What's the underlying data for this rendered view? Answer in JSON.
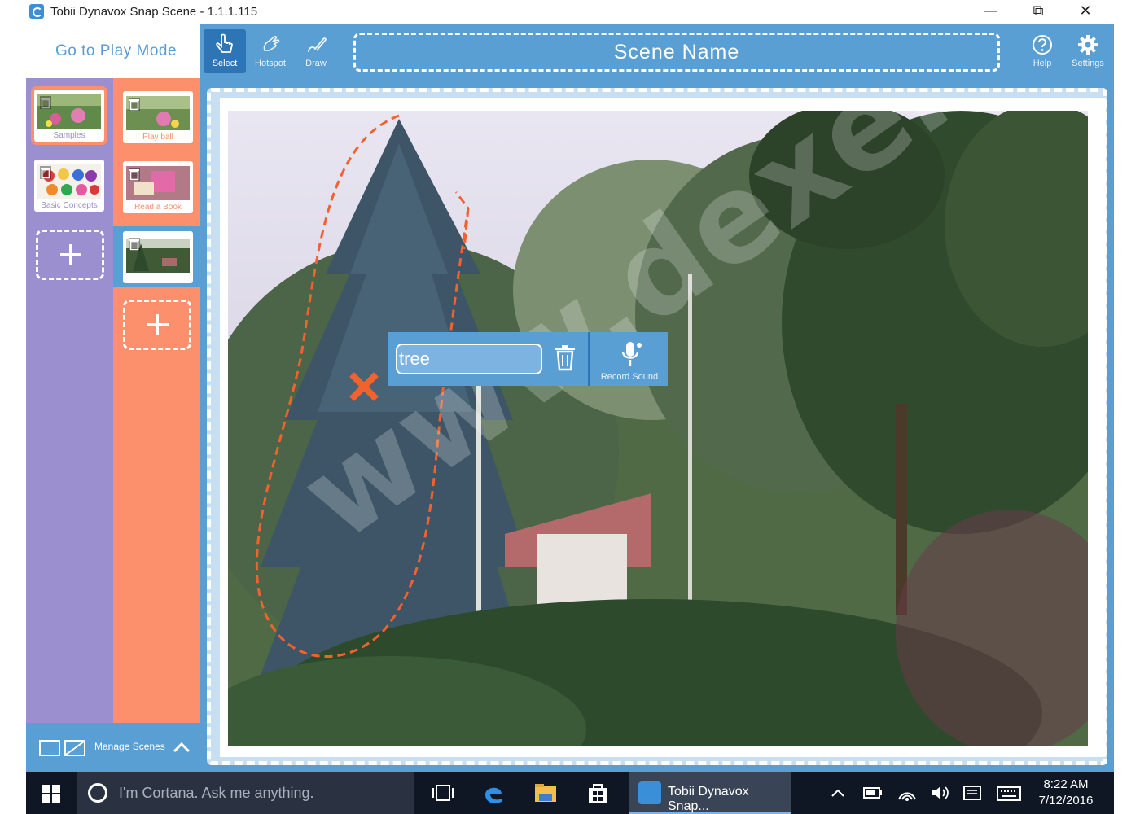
{
  "window": {
    "title": "Tobii Dynavox Snap Scene - 1.1.1.115",
    "minimize": "—",
    "restore": "⧉",
    "close": "✕"
  },
  "header": {
    "play_mode_label": "Go to Play Mode",
    "tools": [
      {
        "label": "Select",
        "icon": "hand-pointer-icon",
        "active": true
      },
      {
        "label": "Hotspot",
        "icon": "hotspot-hand-icon",
        "active": false
      },
      {
        "label": "Draw",
        "icon": "pencil-icon",
        "active": false
      }
    ],
    "scene_name": "Scene Name",
    "help_label": "Help",
    "settings_label": "Settings"
  },
  "folders": [
    {
      "caption": "Samples",
      "selected": true
    },
    {
      "caption": "Basic Concepts",
      "selected": false
    }
  ],
  "scenes": [
    {
      "caption": "Play ball"
    },
    {
      "caption": "Read a Book"
    },
    {
      "caption": "",
      "selected": true
    }
  ],
  "bottom": {
    "manage_label": "Manage Scenes"
  },
  "hotspot": {
    "value": "tree",
    "record_label": "Record Sound"
  },
  "watermark": "www.dexemp...",
  "taskbar": {
    "cortana_placeholder": "I'm Cortana. Ask me anything.",
    "active_app": "Tobii Dynavox Snap...",
    "time": "8:22 AM",
    "date": "7/12/2016"
  },
  "colors": {
    "accent": "#5a9fd4",
    "accent_dark": "#2e75b6",
    "folder_bar": "#9b8fd0",
    "scene_bar": "#fc8f6c",
    "hotspot_outline": "#f2622e"
  }
}
